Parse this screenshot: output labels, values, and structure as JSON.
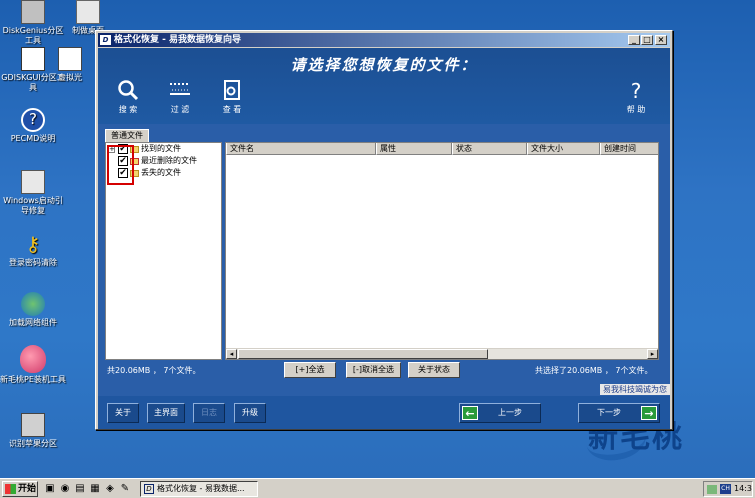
{
  "desktop": {
    "icons": [
      {
        "label": "DiskGenius分区工具"
      },
      {
        "label": "制做桌面"
      },
      {
        "label": "GDISKGUI分区工具"
      },
      {
        "label": "虚拟光"
      },
      {
        "label": "PECMD说明"
      },
      {
        "label": "Windows启动引导修复"
      },
      {
        "label": "登录密码清除"
      },
      {
        "label": "加载网络组件"
      },
      {
        "label": "新毛桃PE装机工具"
      },
      {
        "label": "识别苹果分区"
      }
    ],
    "brand_text": "新毛桃"
  },
  "window": {
    "title": "格式化恢复 - 易我数据恢复向导",
    "app_icon_text": "D",
    "minimize": "_",
    "maximize": "□",
    "close": "×",
    "header_title": "请选择您想恢复的文件：",
    "toolbar": {
      "search": "搜 索",
      "filter": "过 滤",
      "view": "查 看",
      "help": "帮 助"
    },
    "tab_label": "普通文件",
    "tree": [
      {
        "label": "找到的文件",
        "expander": "+",
        "checked": "✔"
      },
      {
        "label": "最近删除的文件",
        "expander": "",
        "checked": "✔"
      },
      {
        "label": "丢失的文件",
        "expander": "",
        "checked": "✔"
      }
    ],
    "columns": [
      "文件名",
      "属性",
      "状态",
      "文件大小",
      "创建时间"
    ],
    "stats_left": "共20.06MB ， 7个文件。",
    "stats_right": "共选择了20.06MB ， 7个文件。",
    "buttons": {
      "select_all": "[+]全选",
      "deselect_all": "[-]取消全选",
      "about_status": "关于状态"
    },
    "copyright": "易我科技竭诚为您",
    "footer": {
      "about": "关于",
      "main": "主界面",
      "log": "日志",
      "upgrade": "升级",
      "prev": "上一步",
      "next": "下一步",
      "prev_arrow": "←",
      "next_arrow": "→"
    }
  },
  "taskbar": {
    "start": "开始",
    "task": "格式化恢复 - 易我数据...",
    "task_icon": "D",
    "lang": "CH",
    "clock": "14:3"
  },
  "colors": {
    "header_blue": "#1f5aa3",
    "titlebar_start": "#0a246a",
    "highlight_red": "#d40000",
    "arrow_green": "#2a9a3a"
  }
}
